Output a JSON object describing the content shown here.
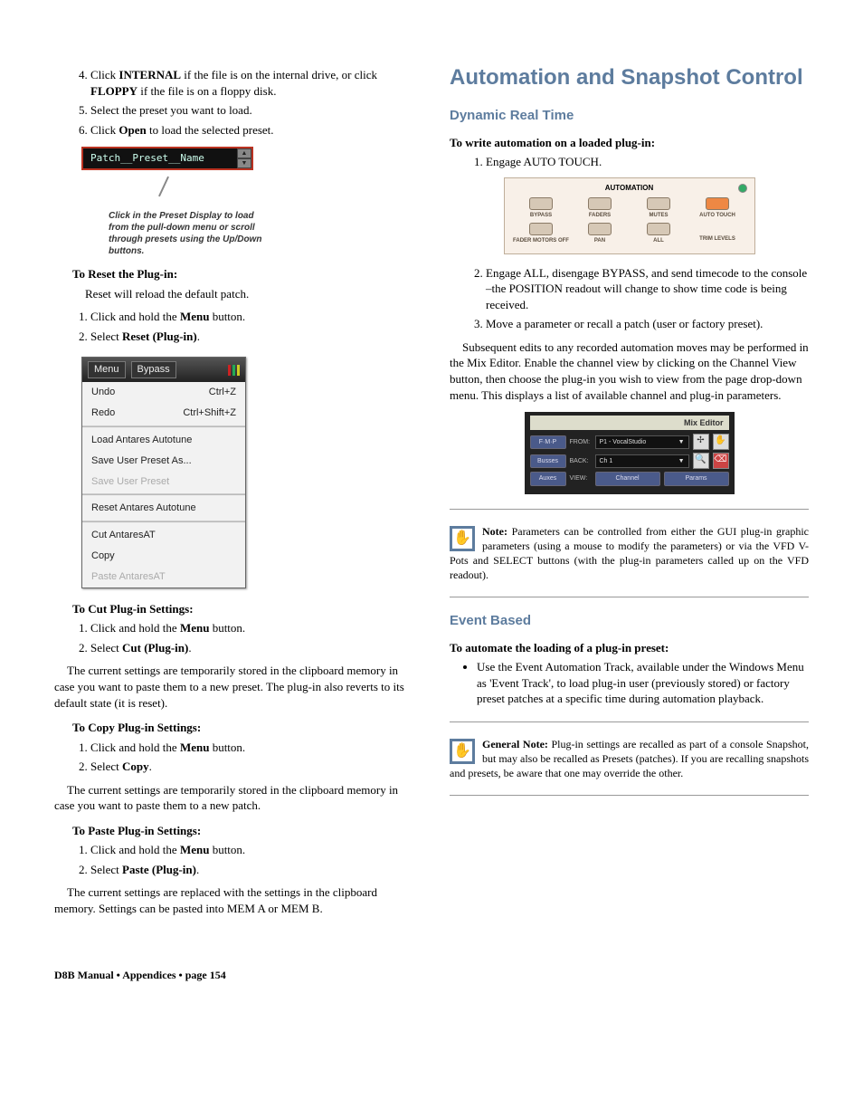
{
  "left": {
    "step4_pre": "Click ",
    "step4_b1": "INTERNAL",
    "step4_mid": " if the file is on the internal drive, or click ",
    "step4_b2": "FLOPPY",
    "step4_post": " if the file is on a floppy disk.",
    "step5": "Select the preset you want to load.",
    "step6_pre": "Click ",
    "step6_b": "Open",
    "step6_post": " to load the selected preset.",
    "preset_name": "Patch__Preset__Name",
    "preset_caption": "Click in the Preset Display to load from the pull-down menu or scroll through presets using the Up/Down buttons.",
    "reset_title": "To Reset the Plug-in:",
    "reset_body": "Reset will reload the default patch.",
    "reset_s1_pre": "Click and hold the ",
    "reset_s1_b": "Menu",
    "reset_s1_post": " button.",
    "reset_s2_pre": "Select ",
    "reset_s2_b": "Reset (Plug-in)",
    "reset_s2_post": ".",
    "menu": {
      "title_menu": "Menu",
      "title_bypass": "Bypass",
      "undo": "Undo",
      "undo_sc": "Ctrl+Z",
      "redo": "Redo",
      "redo_sc": "Ctrl+Shift+Z",
      "load": "Load Antares Autotune",
      "saveas": "Save User Preset As...",
      "save": "Save User Preset",
      "reset": "Reset Antares Autotune",
      "cut": "Cut AntaresAT",
      "copy": "Copy",
      "paste": "Paste AntaresAT"
    },
    "cut_title": "To Cut Plug-in Settings:",
    "cut_s1_pre": "Click and hold the ",
    "cut_s1_b": "Menu",
    "cut_s1_post": " button.",
    "cut_s2_pre": "Select ",
    "cut_s2_b": "Cut (Plug-in)",
    "cut_s2_post": ".",
    "cut_body": "The current settings are temporarily stored in the clipboard memory in case you want to paste them to a new preset. The plug-in also reverts to its default state (it is reset).",
    "copy_title": "To Copy Plug-in Settings:",
    "copy_s1_pre": "Click and hold the ",
    "copy_s1_b": "Menu",
    "copy_s1_post": " button.",
    "copy_s2_pre": "Select ",
    "copy_s2_b": "Copy",
    "copy_s2_post": ".",
    "copy_body": "The current settings are temporarily stored in the clipboard memory in case you want to paste them to a new patch.",
    "paste_title": "To Paste Plug-in Settings:",
    "paste_s1_pre": "Click and hold the ",
    "paste_s1_b": "Menu",
    "paste_s1_post": " button.",
    "paste_s2_pre": "Select ",
    "paste_s2_b": "Paste (Plug-in)",
    "paste_s2_post": ".",
    "paste_body": "The current settings are replaced with the settings in the clipboard memory. Settings can be pasted into MEM A or MEM B."
  },
  "right": {
    "h1": "Automation and Snapshot Control",
    "h2a": "Dynamic Real Time",
    "write_title": "To write automation on a loaded plug-in:",
    "w_s1": "Engage AUTO TOUCH.",
    "auto": {
      "title": "AUTOMATION",
      "bypass": "BYPASS",
      "faders": "FADERS",
      "mutes": "MUTES",
      "autotouch": "AUTO TOUCH",
      "fmo": "FADER MOTORS OFF",
      "pan": "PAN",
      "all": "ALL",
      "trim": "TRIM LEVELS"
    },
    "w_s2": "Engage ALL, disengage BYPASS, and send timecode to the console –the POSITION readout will change to show time code is being received.",
    "w_s3": "Move a parameter or recall a patch (user or factory preset).",
    "para1": "Subsequent edits to any recorded automation moves may be performed in the Mix Editor. Enable the channel view by clicking on the Channel View button, then choose the plug-in you wish to view from the page drop-down menu. This displays a list of available channel and plug-in parameters.",
    "mix": {
      "title": "Mix Editor",
      "fmr": "F·M·P",
      "from_l": "FROM:",
      "from_v": "P1 - VocalStudio",
      "busses": "Busses",
      "back_l": "BACK:",
      "back_v": "Ch 1",
      "auxes": "Auxes",
      "view_l": "VIEW:",
      "channel": "Channel",
      "params": "Params"
    },
    "note1_b": "Note:",
    "note1": " Parameters can be controlled from either the GUI plug-in graphic parameters (using a mouse to modify the parameters) or via the VFD V-Pots and SELECT buttons (with the plug-in parameters called up on the VFD readout).",
    "h2b": "Event Based",
    "ev_title": "To automate the loading of a plug-in preset:",
    "ev_bullet": "Use the Event Automation Track, available under the Windows Menu as 'Event Track', to load plug-in user (previously stored) or factory preset patches at a specific time during automation playback.",
    "note2_b": "General Note:",
    "note2": " Plug-in settings are recalled as part of a console Snapshot, but may also be recalled as Presets (patches). If you are recalling snapshots and presets, be aware that one may override the other."
  },
  "footer": "D8B Manual • Appendices • page  154"
}
